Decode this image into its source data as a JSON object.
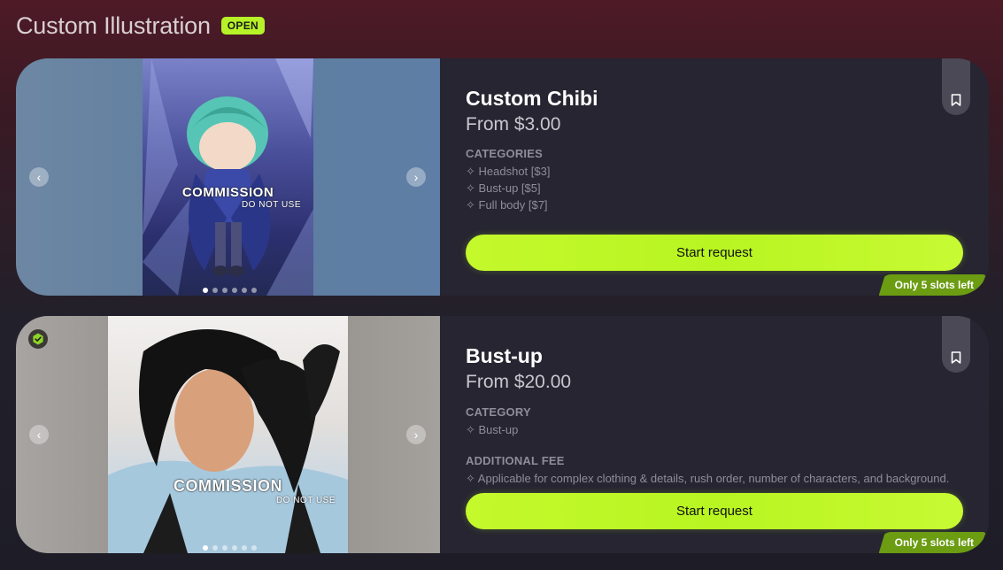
{
  "header": {
    "title": "Custom Illustration",
    "status_badge": "OPEN"
  },
  "colors": {
    "accent": "#b6f227",
    "card_bg": "#262531",
    "slots_badge": "#6b9c12"
  },
  "cards": [
    {
      "title": "Custom Chibi",
      "price": "From $3.00",
      "watermark": "COMMISSION",
      "watermark_sub": "DO NOT USE",
      "gallery_images": 6,
      "active_image": 1,
      "verified": false,
      "sections": [
        {
          "label": "CATEGORIES",
          "items": [
            "✧ Headshot [$3]",
            "✧ Bust-up [$5]",
            "✧ Full body [$7]"
          ]
        }
      ],
      "cta_label": "Start request",
      "slots_label": "Only 5 slots left"
    },
    {
      "title": "Bust-up",
      "price": "From $20.00",
      "watermark": "COMMISSION",
      "watermark_sub": "DO NOT USE",
      "gallery_images": 6,
      "active_image": 1,
      "verified": true,
      "sections": [
        {
          "label": "CATEGORY",
          "items": [
            "✧ Bust-up"
          ]
        },
        {
          "label": "ADDITIONAL FEE",
          "items": [
            "✧ Applicable for complex clothing & details, rush order, number of characters, and background."
          ]
        }
      ],
      "cta_label": "Start request",
      "slots_label": "Only 5 slots left"
    }
  ],
  "icons": {
    "prev": "chevron-left-icon",
    "next": "chevron-right-icon",
    "bookmark": "bookmark-icon",
    "verified": "verified-check-icon"
  }
}
